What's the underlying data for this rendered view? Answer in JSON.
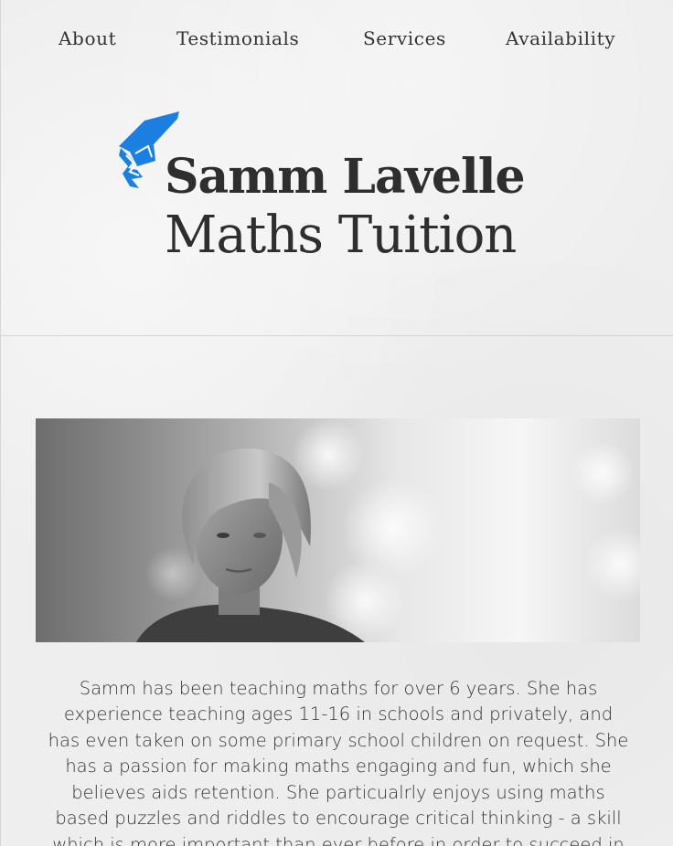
{
  "nav": {
    "items": [
      {
        "label": "About"
      },
      {
        "label": "Testimonials"
      },
      {
        "label": "Services"
      },
      {
        "label": "Availability"
      }
    ]
  },
  "header": {
    "logo_icon": "graduation-cap-icon",
    "name": "Samm Lavelle",
    "tagline": "Maths Tuition",
    "accent_color": "#1a7fe0"
  },
  "hero": {
    "image": "portrait-photo"
  },
  "about": {
    "bio": "Samm has been teaching maths for over 6 years. She has experience teaching ages 11-16 in schools and privately, and has even taken on some primary school children on request. She has a passion for making maths engaging and fun, which she believes aids retention. She particualrly enjoys using maths based puzzles and riddles to encourage critical thinking - a skill which is more important than ever before in order to succeed in"
  }
}
